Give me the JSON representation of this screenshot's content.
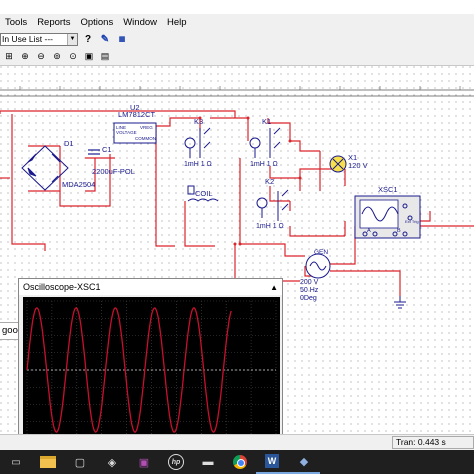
{
  "menu": {
    "items": [
      "Tools",
      "Reports",
      "Options",
      "Window",
      "Help"
    ],
    "underline": [
      "T",
      "R",
      "O",
      "W",
      "H"
    ]
  },
  "toolbar": {
    "combo_value": "In Use List ---"
  },
  "schematic": {
    "components": {
      "bridge": "D1",
      "bridge_model": "MDA2504",
      "regulator_ref": "U2",
      "regulator_model": "LM7812CT",
      "regulator_pins": [
        "LINE",
        "VREG",
        "VOLTAGE",
        "COMMON"
      ],
      "capacitor_ref": "C1",
      "capacitor_value": "2200uF-POL",
      "relay_k3": "K3",
      "relay_k1": "K1",
      "relay_k2": "K2",
      "inductor_k3": "1mH 1 Ω",
      "inductor_k1": "1mH 1 Ω",
      "inductor_k2": "1mH 1 Ω",
      "coil": "COIL",
      "lamp_ref": "X1",
      "lamp_value": "120 V",
      "scope_ref": "XSC1",
      "scope_terminals": [
        "A",
        "B",
        "Ext Trig"
      ],
      "gen_ref": "GEN",
      "gen_lines": [
        "200 V",
        "50 Hz",
        "0Deg"
      ]
    },
    "colors": {
      "wire": "#d9252c",
      "wire_blue": "#1a3fb0",
      "component": "#1a1a8c"
    }
  },
  "status_left": "good",
  "oscilloscope": {
    "title": "Oscilloscope-XSC1",
    "close_icon": "close-icon"
  },
  "statusbar": {
    "tran": "Tran: 0.443 s"
  },
  "chart_data": {
    "type": "line",
    "series": [
      {
        "color": "#c8102e",
        "shape": "sine",
        "cycles": 5.2,
        "amplitude": 0.45
      }
    ],
    "grid": true
  }
}
